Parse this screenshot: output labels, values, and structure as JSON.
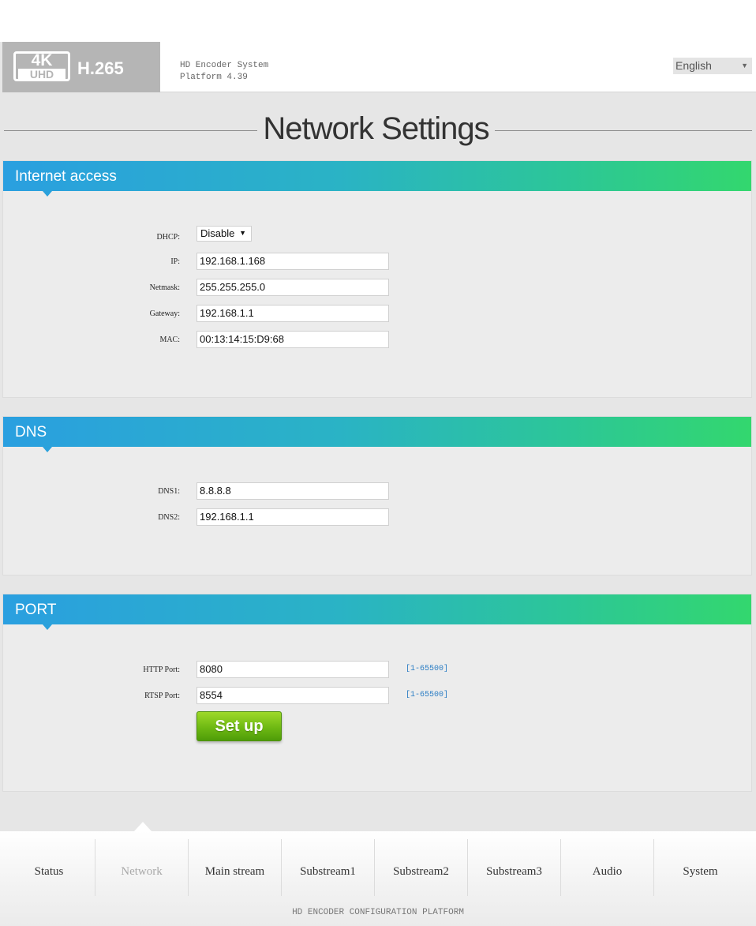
{
  "header": {
    "logo_4k": "4K",
    "logo_uhd": "UHD",
    "logo_codec": "H.265",
    "system_name": "HD Encoder System",
    "platform_version": "Platform 4.39",
    "language": "English"
  },
  "page_title": "Network Settings",
  "internet_access": {
    "title": "Internet access",
    "dhcp_label": "DHCP:",
    "dhcp_value": "Disable",
    "ip_label": "IP:",
    "ip_value": "192.168.1.168",
    "netmask_label": "Netmask:",
    "netmask_value": "255.255.255.0",
    "gateway_label": "Gateway:",
    "gateway_value": "192.168.1.1",
    "mac_label": "MAC:",
    "mac_value": "00:13:14:15:D9:68"
  },
  "dns": {
    "title": "DNS",
    "dns1_label": "DNS1:",
    "dns1_value": "8.8.8.8",
    "dns2_label": "DNS2:",
    "dns2_value": "192.168.1.1"
  },
  "port": {
    "title": "PORT",
    "http_label": "HTTP Port:",
    "http_value": "8080",
    "http_range": "[1-65500]",
    "rtsp_label": "RTSP Port:",
    "rtsp_value": "8554",
    "rtsp_range": "[1-65500]",
    "setup_label": "Set up"
  },
  "nav": {
    "status": "Status",
    "network": "Network",
    "main_stream": "Main stream",
    "substream1": "Substream1",
    "substream2": "Substream2",
    "substream3": "Substream3",
    "audio": "Audio",
    "system": "System"
  },
  "footer": "HD ENCODER CONFIGURATION PLATFORM"
}
